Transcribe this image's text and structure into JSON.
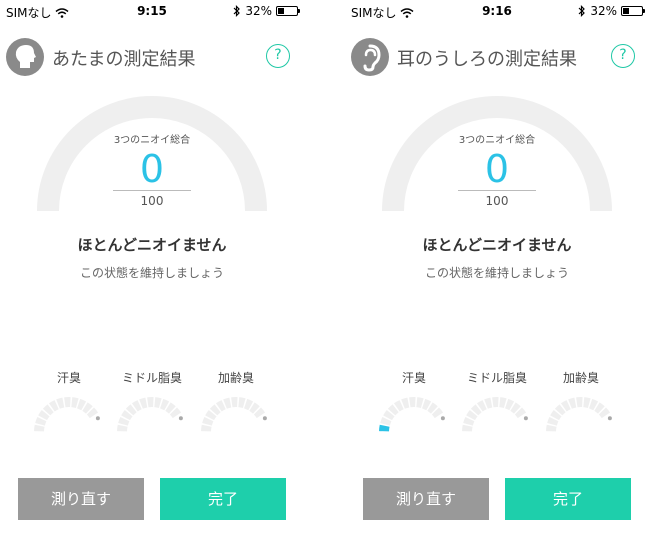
{
  "screens": [
    {
      "status": {
        "carrier": "SIMなし",
        "time": "9:15",
        "battery": "32%",
        "battery_level": 0.32
      },
      "title": "あたまの測定結果",
      "help": "?",
      "caption": "3つのニオイ総合",
      "score": "0",
      "max": "100",
      "message": "ほとんどニオイません",
      "sub_message": "この状態を維持しましょう",
      "categories": [
        {
          "label": "汗臭",
          "level": 0
        },
        {
          "label": "ミドル脂臭",
          "level": 0
        },
        {
          "label": "加齢臭",
          "level": 0
        }
      ],
      "retry_label": "測り直す",
      "done_label": "完了",
      "icon": "head-profile-icon"
    },
    {
      "status": {
        "carrier": "SIMなし",
        "time": "9:16",
        "battery": "32%",
        "battery_level": 0.32
      },
      "title": "耳のうしろの測定結果",
      "help": "?",
      "caption": "3つのニオイ総合",
      "score": "0",
      "max": "100",
      "message": "ほとんどニオイません",
      "sub_message": "この状態を維持しましょう",
      "categories": [
        {
          "label": "汗臭",
          "level": 0.05
        },
        {
          "label": "ミドル脂臭",
          "level": 0
        },
        {
          "label": "加齢臭",
          "level": 0
        }
      ],
      "retry_label": "測り直す",
      "done_label": "完了",
      "icon": "ear-icon"
    }
  ],
  "colors": {
    "accent": "#1ecfab",
    "score": "#2bc2e6",
    "gauge_track": "#efefef",
    "retry": "#999999"
  }
}
